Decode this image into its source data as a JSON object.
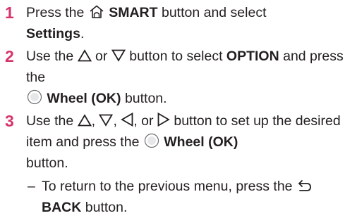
{
  "steps": [
    {
      "number": "1",
      "t1": "Press the",
      "smart_label": "SMART",
      "t2": "button and select",
      "settings_label": "Settings",
      "t3": "."
    },
    {
      "number": "2",
      "t1": "Use the",
      "or": "or",
      "t2": "button to select",
      "option_label": "OPTION",
      "t3": "and press the",
      "wheel_label": "Wheel (OK)",
      "t4": "button."
    },
    {
      "number": "3",
      "t1": "Use the",
      "comma1": ",",
      "comma2": ",",
      "or": ", or",
      "t2": "button to set up the desired item and press the",
      "wheel_label": "Wheel (OK)",
      "t3": "button.",
      "sub_dash": "–",
      "sub_t1": "To return to the previous menu, press the",
      "back_label": "BACK",
      "sub_t2": "button."
    }
  ],
  "icons": [
    "home-icon",
    "up-triangle-icon",
    "down-triangle-icon",
    "left-triangle-icon",
    "right-triangle-icon",
    "wheel-button-icon",
    "back-arrow-icon"
  ],
  "colors": {
    "step_number": "#d6336c",
    "text": "#231f20"
  }
}
